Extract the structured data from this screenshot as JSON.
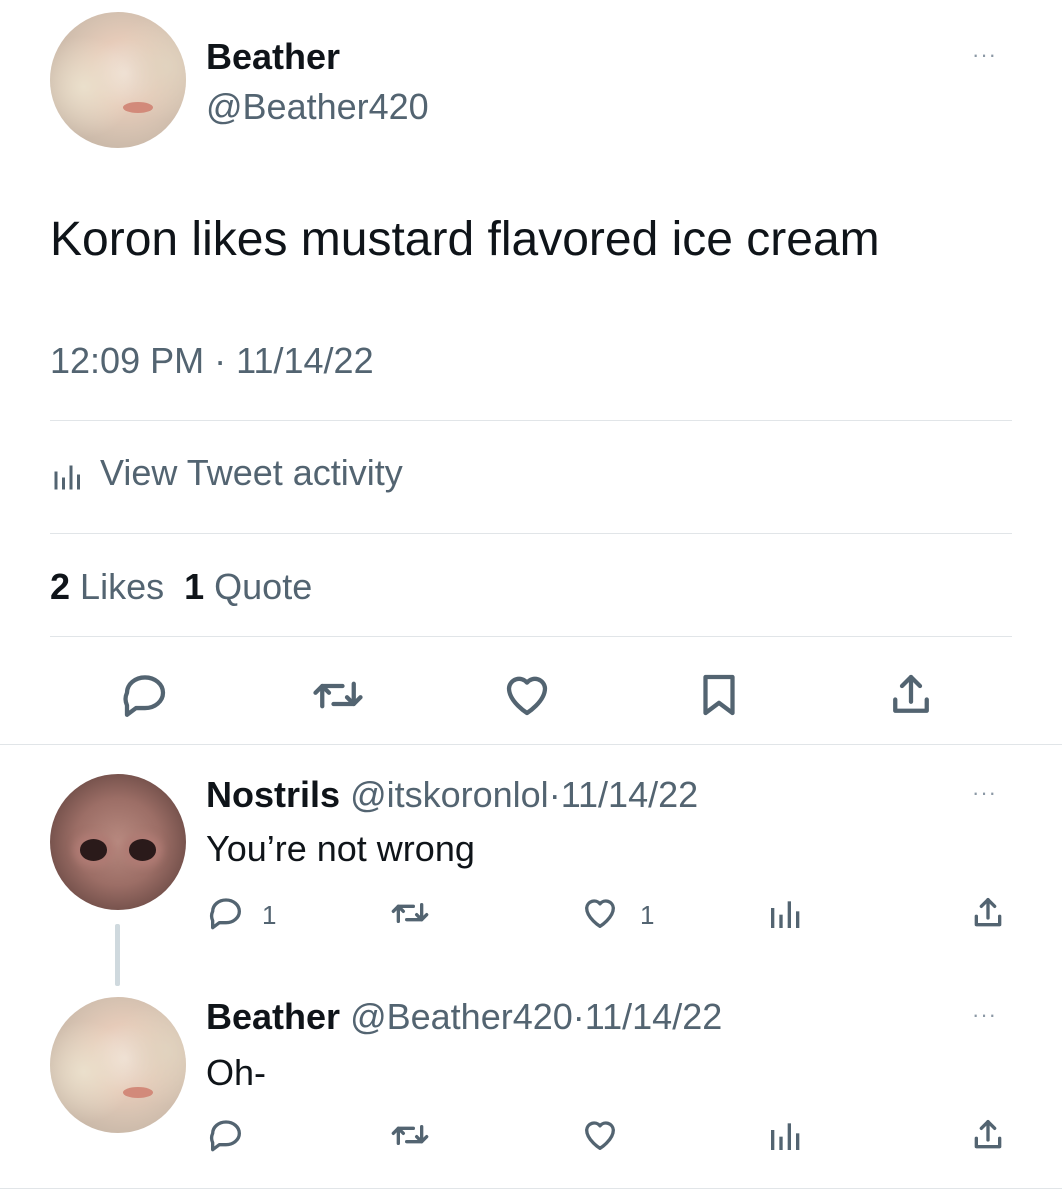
{
  "tweet": {
    "author_name": "Beather",
    "author_handle": "@Beather420",
    "text": "Koron likes mustard flavored ice cream",
    "time": "12:09 PM",
    "sep": "·",
    "date": "11/14/22",
    "activity_label": "View Tweet activity",
    "likes_count": "2",
    "likes_label": "Likes",
    "quotes_count": "1",
    "quotes_label": "Quote",
    "more_label": "···"
  },
  "replies": [
    {
      "name": "Nostrils",
      "handle": "@itskoronlol",
      "sep": "·",
      "date": "11/14/22",
      "text": "You’re not wrong",
      "reply_count": "1",
      "like_count": "1",
      "more_label": "···"
    },
    {
      "name": "Beather",
      "handle": "@Beather420",
      "sep": "·",
      "date": "11/14/22",
      "text": "Oh-",
      "reply_count": "",
      "like_count": "",
      "more_label": "···"
    }
  ],
  "colors": {
    "text": "#0f1419",
    "muted": "#536471",
    "divider": "#e1e5e8",
    "thread_line": "#cfd9de"
  },
  "icons": [
    "reply-icon",
    "retweet-icon",
    "like-icon",
    "bookmark-icon",
    "share-icon",
    "analytics-icon",
    "more-icon"
  ]
}
